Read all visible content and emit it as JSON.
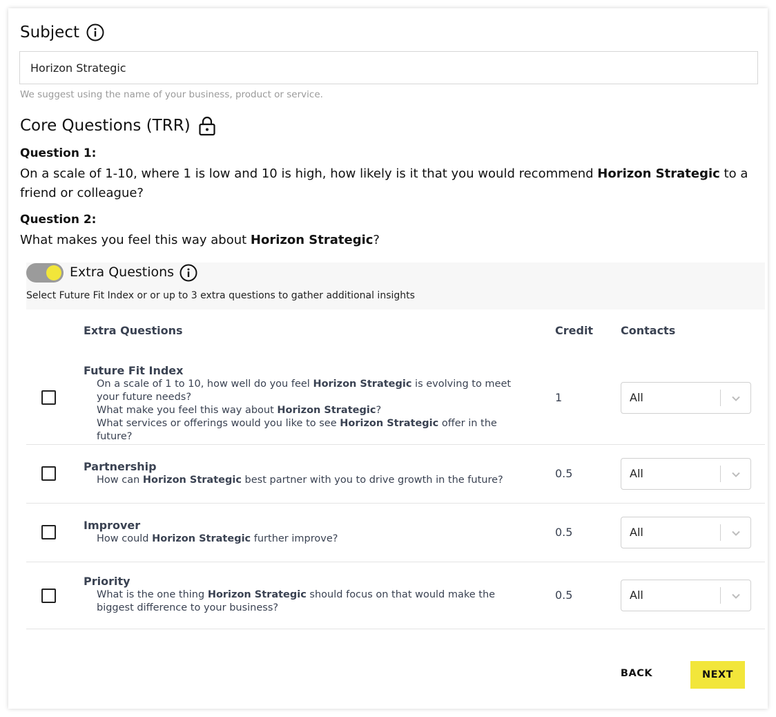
{
  "subject": {
    "title": "Subject",
    "value": "Horizon Strategic",
    "hint": "We suggest using the name of your business, product or service."
  },
  "core": {
    "title": "Core Questions (TRR)",
    "q1_label": "Question 1:",
    "q1_pre": "On a scale of 1-10, where 1 is low and 10 is high, how likely is it that you would recommend ",
    "q1_brand": "Horizon Strategic",
    "q1_post": " to a friend or colleague?",
    "q2_label": "Question 2:",
    "q2_pre": "What makes you feel this way about ",
    "q2_brand": "Horizon Strategic",
    "q2_post": "?"
  },
  "extra": {
    "toggle_on": true,
    "title": "Extra Questions",
    "subtitle": "Select Future Fit Index or or up to 3 extra questions to gather additional insights"
  },
  "table": {
    "headers": {
      "questions": "Extra Questions",
      "credit": "Credit",
      "contacts": "Contacts"
    },
    "rows": [
      {
        "title": "Future Fit Index",
        "lines": [
          {
            "pre": "On a scale of 1 to 10, how well do you feel ",
            "brand": "Horizon Strategic",
            "post": " is evolving to meet your future needs?"
          },
          {
            "pre": "What make you feel this way about ",
            "brand": "Horizon Strategic",
            "post": "?"
          },
          {
            "pre": "What services or offerings would you like to see ",
            "brand": "Horizon Strategic",
            "post": " offer in the future?"
          }
        ],
        "credit": "1",
        "contacts": "All"
      },
      {
        "title": "Partnership",
        "lines": [
          {
            "pre": "How can ",
            "brand": "Horizon Strategic",
            "post": " best partner with you to drive growth in the future?"
          }
        ],
        "credit": "0.5",
        "contacts": "All"
      },
      {
        "title": "Improver",
        "lines": [
          {
            "pre": "How could ",
            "brand": "Horizon Strategic",
            "post": " further improve?"
          }
        ],
        "credit": "0.5",
        "contacts": "All"
      },
      {
        "title": "Priority",
        "lines": [
          {
            "pre": "What is the one thing ",
            "brand": "Horizon Strategic",
            "post": " should focus on that would make the biggest difference to your business?"
          }
        ],
        "credit": "0.5",
        "contacts": "All"
      }
    ]
  },
  "buttons": {
    "back": "BACK",
    "next": "NEXT"
  },
  "colors": {
    "accent": "#f2e63a",
    "toggle_track": "#9b9b9b",
    "text_muted": "#3a4252"
  }
}
